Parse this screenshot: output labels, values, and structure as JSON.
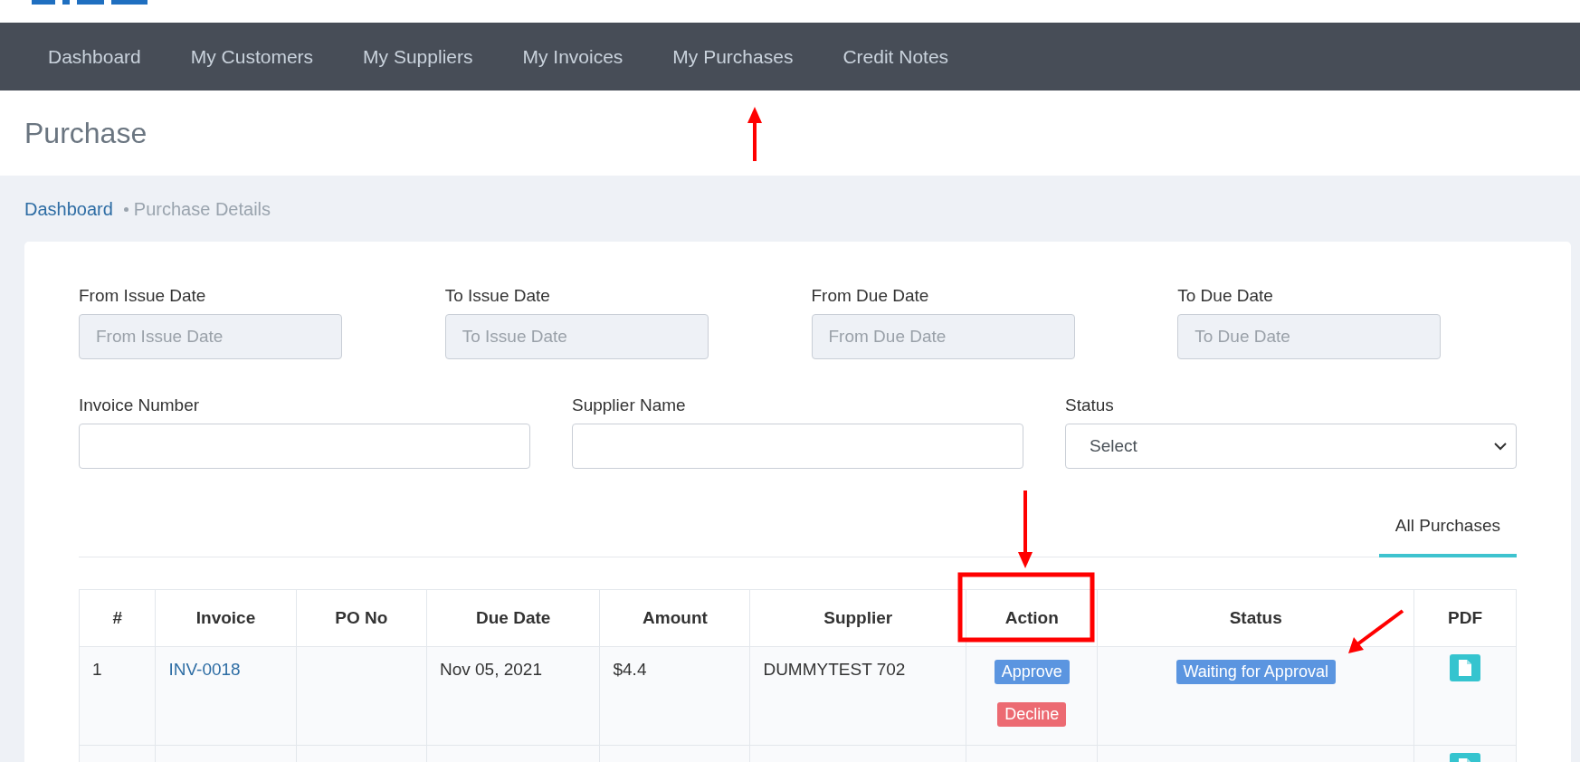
{
  "nav": {
    "items": [
      {
        "label": "Dashboard",
        "selected": false
      },
      {
        "label": "My Customers",
        "selected": false
      },
      {
        "label": "My Suppliers",
        "selected": false
      },
      {
        "label": "My Invoices",
        "selected": false
      },
      {
        "label": "My Purchases",
        "selected": false
      },
      {
        "label": "Credit Notes",
        "selected": false
      }
    ]
  },
  "page_title": "Purchase",
  "breadcrumb": [
    {
      "label": "Dashboard",
      "kind": "link"
    },
    {
      "label": "Purchase Details",
      "kind": "current"
    }
  ],
  "filters": [
    {
      "label": "From Issue Date",
      "placeholder": "From Issue Date",
      "kind": "date"
    },
    {
      "label": "To Issue Date",
      "placeholder": "To Issue Date",
      "kind": "date"
    },
    {
      "label": "From Due Date",
      "placeholder": "From Due Date",
      "kind": "date"
    },
    {
      "label": "To Due Date",
      "placeholder": "To Due Date",
      "kind": "date"
    },
    {
      "label": "Invoice Number",
      "kind": "text"
    },
    {
      "label": "Supplier Name",
      "kind": "text"
    },
    {
      "label": "Status",
      "value": "Select",
      "kind": "select"
    }
  ],
  "tabs": [
    {
      "label": "All Purchases",
      "selected": true
    }
  ],
  "table": {
    "columns": [
      "#",
      "Invoice",
      "PO No",
      "Due Date",
      "Amount",
      "Supplier",
      "Action",
      "Status",
      "PDF"
    ],
    "rows": [
      {
        "number": "1",
        "invoice": "INV-0018",
        "due_date": "Nov 05, 2021",
        "amount": "$4.4",
        "supplier": "DUMMYTEST 702",
        "actions": [
          {
            "label": "Approve",
            "kind": "approve"
          },
          {
            "label": "Decline",
            "kind": "decline"
          }
        ],
        "status": "Waiting for Approval",
        "pdf": true
      },
      {
        "pdf": true
      }
    ]
  }
}
